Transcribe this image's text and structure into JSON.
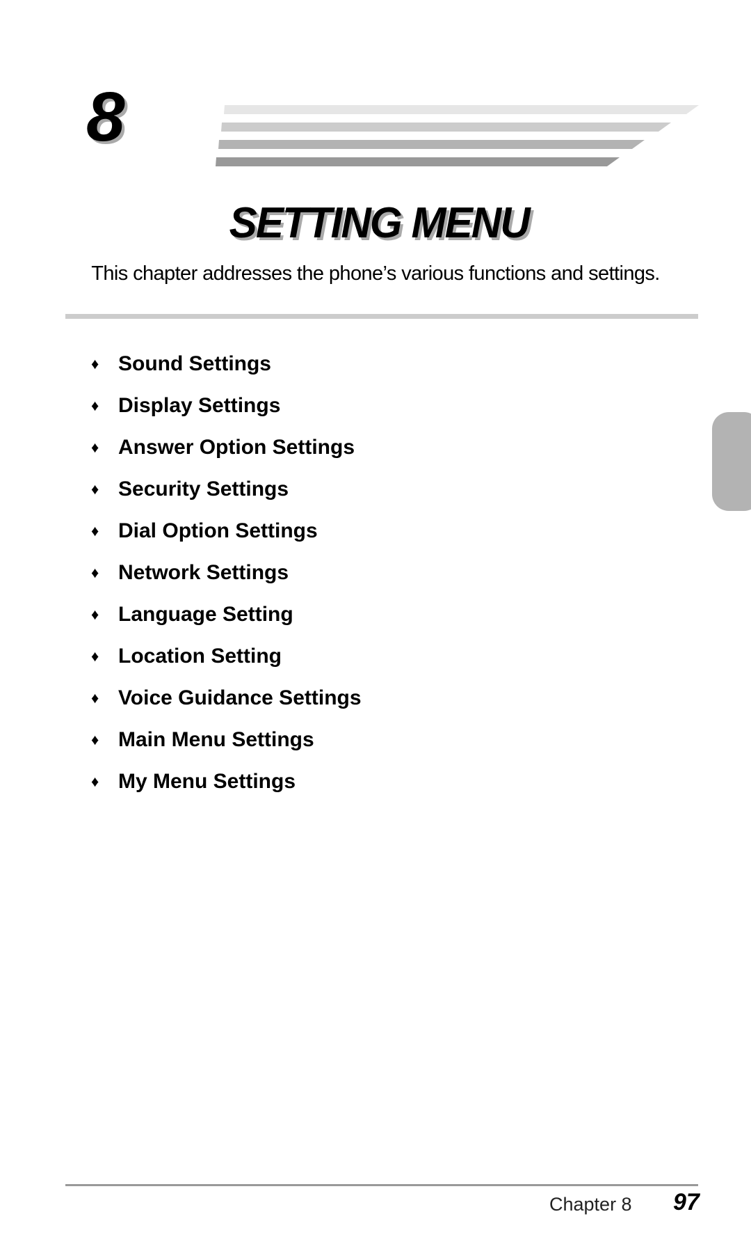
{
  "header": {
    "chapter_number": "8",
    "title": "SETTING MENU",
    "intro": "This chapter addresses the phone’s various functions and settings."
  },
  "colors": {
    "stripes": [
      "#e6e6e6",
      "#cccccc",
      "#b3b3b3",
      "#999999"
    ],
    "rule": "#cccccc",
    "side_tab": "#b3b3b3"
  },
  "contents": {
    "bullet_glyph": "♦",
    "items": [
      {
        "label": "Sound Settings"
      },
      {
        "label": "Display Settings"
      },
      {
        "label": "Answer Option Settings"
      },
      {
        "label": "Security Settings"
      },
      {
        "label": "Dial Option Settings"
      },
      {
        "label": "Network Settings"
      },
      {
        "label": "Language Setting"
      },
      {
        "label": "Location Setting"
      },
      {
        "label": "Voice Guidance Settings"
      },
      {
        "label": "Main Menu Settings"
      },
      {
        "label": "My Menu Settings"
      }
    ]
  },
  "footer": {
    "chapter_label": "Chapter 8",
    "page_number": "97"
  }
}
